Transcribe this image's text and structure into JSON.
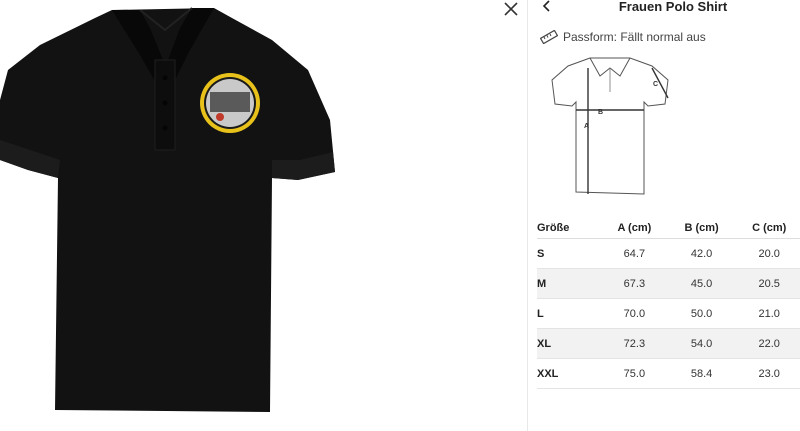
{
  "header": {
    "title": "Frauen Polo Shirt"
  },
  "icons": {
    "close": "close-icon",
    "back": "chevron-left-icon",
    "ruler": "ruler-icon"
  },
  "fit": {
    "label": "Passform: Fällt normal aus"
  },
  "diagram": {
    "label_a": "A",
    "label_b": "B",
    "label_c": "C"
  },
  "size_table": {
    "headers": [
      "Größe",
      "A (cm)",
      "B (cm)",
      "C (cm)"
    ],
    "rows": [
      [
        "S",
        "64.7",
        "42.0",
        "20.0"
      ],
      [
        "M",
        "67.3",
        "45.0",
        "20.5"
      ],
      [
        "L",
        "70.0",
        "50.0",
        "21.0"
      ],
      [
        "XL",
        "72.3",
        "54.0",
        "22.0"
      ],
      [
        "XXL",
        "75.0",
        "58.4",
        "23.0"
      ]
    ]
  },
  "colors": {
    "shirt": "#101010",
    "badge_ring": "#e8c21a",
    "row_alt": "#f2f2f2"
  }
}
